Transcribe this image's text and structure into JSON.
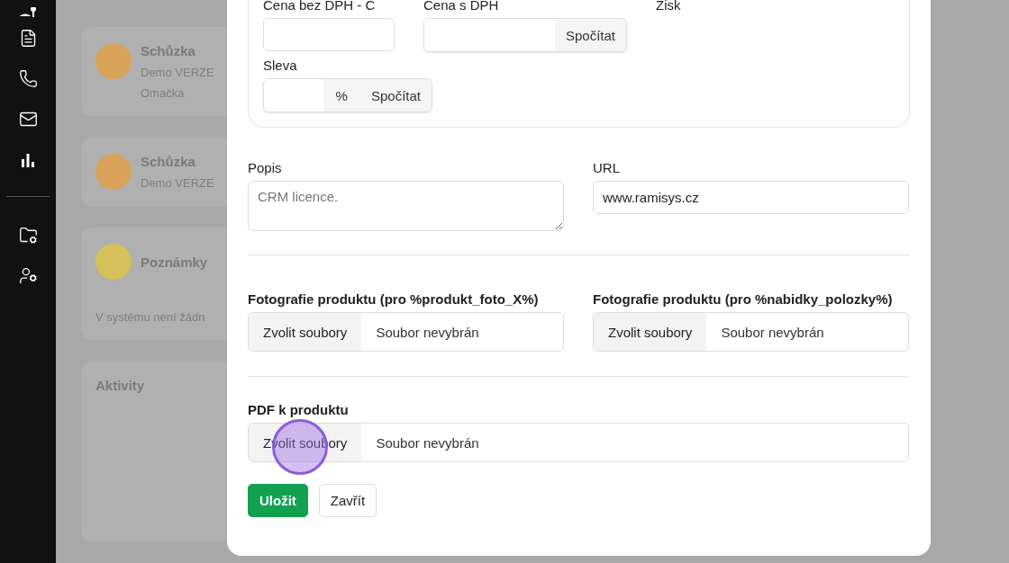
{
  "sidebar": {
    "items": [
      {
        "kind": "user-key"
      },
      {
        "kind": "document"
      },
      {
        "kind": "phone"
      },
      {
        "kind": "mail"
      },
      {
        "kind": "chart"
      },
      {
        "kind": "divider"
      },
      {
        "kind": "folder"
      },
      {
        "kind": "user-settings"
      }
    ]
  },
  "background": {
    "meetings": [
      {
        "title": "Schůzka",
        "lines": [
          "Demo VERZE",
          "Omačka"
        ]
      },
      {
        "title": "Schůzka",
        "lines": [
          "Demo VERZE"
        ]
      }
    ],
    "notes": {
      "title": "Poznámky",
      "text": "V systému není žádn"
    },
    "activity": {
      "title": "Aktivity"
    }
  },
  "modal": {
    "price_card": {
      "fields": [
        {
          "label": "Cena bez DPH - C",
          "kind": "input"
        },
        {
          "label": "Cena s DPH",
          "kind": "calc",
          "button": "Spočítat"
        },
        {
          "label": "Zisk",
          "kind": "empty"
        }
      ],
      "discount": {
        "label": "Sleva",
        "addon": "%",
        "button": "Spočítat"
      }
    },
    "description": {
      "label": "Popis",
      "placeholder": "CRM licence."
    },
    "url": {
      "label": "URL",
      "value": "www.ramisys.cz"
    },
    "photos": [
      {
        "label": "Fotografie produktu (pro %produkt_foto_X%)",
        "button": "Zvolit soubory",
        "status": "Soubor nevybrán"
      },
      {
        "label": "Fotografie produktu (pro %nabidky_polozky%)",
        "button": "Zvolit soubory",
        "status": "Soubor nevybrán"
      }
    ],
    "pdf": {
      "label": "PDF k produktu",
      "button": "Zvolit soubory",
      "status": "Soubor nevybrán"
    },
    "actions": [
      {
        "label": "Uložit",
        "kind": "primary"
      },
      {
        "label": "Zavřít",
        "kind": "secondary"
      }
    ]
  }
}
